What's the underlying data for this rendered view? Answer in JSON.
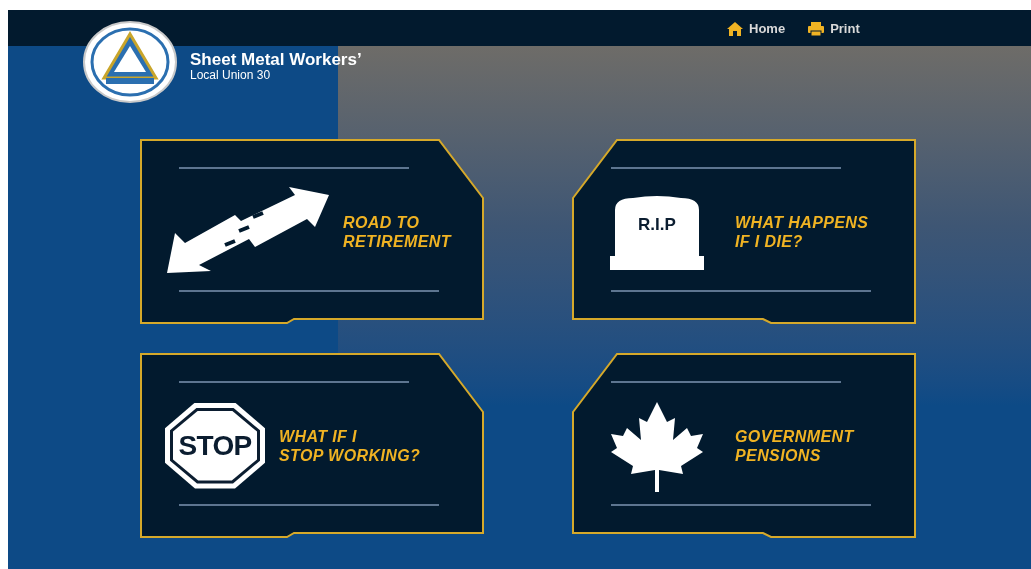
{
  "header": {
    "title": "Sheet Metal Workers’",
    "subtitle": "Local Union 30"
  },
  "nav": [
    {
      "label": "Home",
      "kind": "home"
    },
    {
      "label": "Print",
      "kind": "print"
    }
  ],
  "cards": [
    {
      "kind": "road",
      "lines": [
        "ROAD TO",
        "RETIREMENT"
      ]
    },
    {
      "kind": "tombstone",
      "icon_text": "R.I.P",
      "lines": [
        "WHAT HAPPENS",
        "IF I DIE?"
      ]
    },
    {
      "kind": "stop",
      "icon_text": "STOP",
      "lines": [
        "WHAT IF I",
        "STOP WORKING?"
      ]
    },
    {
      "kind": "maple-leaf",
      "lines": [
        "GOVERNMENT",
        "PENSIONS"
      ]
    }
  ]
}
